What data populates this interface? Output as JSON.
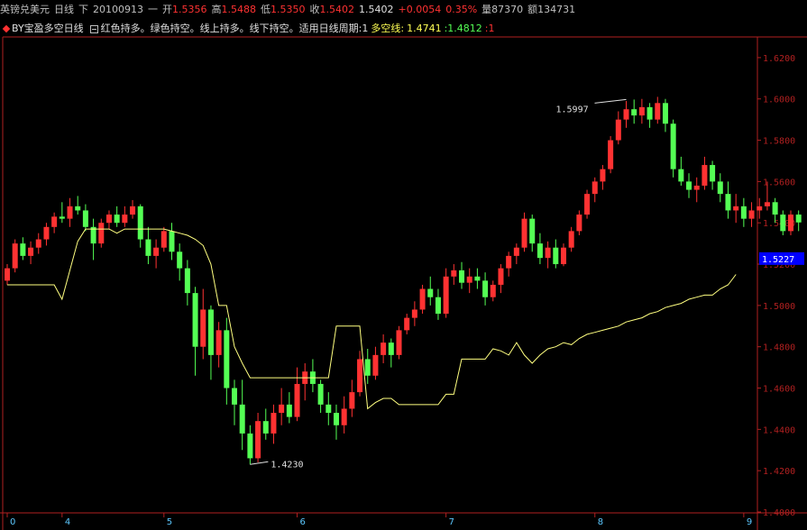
{
  "header": {
    "symbol": "英镑兑美元",
    "period": "日线",
    "direction": "下",
    "date": "20100913",
    "weekday": "一",
    "open_label": "开",
    "open": "1.5356",
    "high_label": "高",
    "high": "1.5488",
    "low_label": "低",
    "low": "1.5350",
    "close_label": "收",
    "close": "1.5402",
    "last": "1.5402",
    "change": "+0.0054",
    "change_pct": "0.35%",
    "volume_label": "量",
    "volume": "87370",
    "amount_label": "额",
    "amount": "134731"
  },
  "indicator": {
    "name": "BY宝盈多空日线",
    "description": "红色持多。绿色持空。线上持多。线下持空。适用日线周期:1",
    "line_label": "多空线:",
    "line_value": "1.4741",
    "value2": ":1.4812",
    "value3": ":1"
  },
  "colors": {
    "up": "#ff3232",
    "down": "#54ff54",
    "line": "#ffff80",
    "axis": "#b02020",
    "current_bg": "#0000ff"
  },
  "chart_data": {
    "type": "candlestick",
    "ylim": [
      1.4,
      1.63
    ],
    "y_ticks": [
      "1.6200",
      "1.6000",
      "1.5800",
      "1.5600",
      "1.5400",
      "1.5200",
      "1.5000",
      "1.4800",
      "1.4600",
      "1.4400",
      "1.4200",
      "1.4000"
    ],
    "x_ticks": [
      {
        "label": "0",
        "index": 0
      },
      {
        "label": "4",
        "index": 7
      },
      {
        "label": "5",
        "index": 20
      },
      {
        "label": "6",
        "index": 37
      },
      {
        "label": "7",
        "index": 56
      },
      {
        "label": "8",
        "index": 75
      },
      {
        "label": "9",
        "index": 94
      }
    ],
    "current_price": "1.5227",
    "annotations": [
      {
        "text": "1.5997",
        "index": 79,
        "value": 1.5997
      },
      {
        "text": "1.4230",
        "index": 31,
        "value": 1.423
      }
    ],
    "candles": [
      [
        1.512,
        1.52,
        1.51,
        1.518
      ],
      [
        1.518,
        1.532,
        1.516,
        1.53
      ],
      [
        1.53,
        1.533,
        1.522,
        1.524
      ],
      [
        1.524,
        1.531,
        1.52,
        1.528
      ],
      [
        1.528,
        1.535,
        1.525,
        1.532
      ],
      [
        1.532,
        1.54,
        1.529,
        1.538
      ],
      [
        1.538,
        1.545,
        1.535,
        1.543
      ],
      [
        1.543,
        1.55,
        1.54,
        1.542
      ],
      [
        1.542,
        1.552,
        1.538,
        1.548
      ],
      [
        1.548,
        1.553,
        1.544,
        1.546
      ],
      [
        1.546,
        1.549,
        1.536,
        1.538
      ],
      [
        1.538,
        1.542,
        1.522,
        1.53
      ],
      [
        1.53,
        1.542,
        1.528,
        1.54
      ],
      [
        1.54,
        1.546,
        1.537,
        1.544
      ],
      [
        1.544,
        1.548,
        1.538,
        1.54
      ],
      [
        1.54,
        1.548,
        1.538,
        1.544
      ],
      [
        1.544,
        1.551,
        1.542,
        1.548
      ],
      [
        1.548,
        1.549,
        1.528,
        1.532
      ],
      [
        1.532,
        1.538,
        1.52,
        1.524
      ],
      [
        1.524,
        1.532,
        1.518,
        1.528
      ],
      [
        1.528,
        1.538,
        1.526,
        1.536
      ],
      [
        1.536,
        1.54,
        1.522,
        1.526
      ],
      [
        1.526,
        1.53,
        1.512,
        1.518
      ],
      [
        1.518,
        1.522,
        1.5,
        1.506
      ],
      [
        1.506,
        1.509,
        1.466,
        1.48
      ],
      [
        1.48,
        1.508,
        1.474,
        1.498
      ],
      [
        1.498,
        1.5,
        1.464,
        1.476
      ],
      [
        1.476,
        1.492,
        1.47,
        1.488
      ],
      [
        1.488,
        1.494,
        1.452,
        1.46
      ],
      [
        1.46,
        1.464,
        1.442,
        1.452
      ],
      [
        1.452,
        1.464,
        1.43,
        1.438
      ],
      [
        1.438,
        1.442,
        1.423,
        1.426
      ],
      [
        1.426,
        1.448,
        1.424,
        1.444
      ],
      [
        1.444,
        1.45,
        1.435,
        1.438
      ],
      [
        1.438,
        1.452,
        1.433,
        1.448
      ],
      [
        1.448,
        1.46,
        1.442,
        1.452
      ],
      [
        1.452,
        1.458,
        1.443,
        1.446
      ],
      [
        1.446,
        1.47,
        1.444,
        1.462
      ],
      [
        1.462,
        1.472,
        1.454,
        1.468
      ],
      [
        1.468,
        1.474,
        1.458,
        1.462
      ],
      [
        1.462,
        1.464,
        1.448,
        1.452
      ],
      [
        1.452,
        1.458,
        1.442,
        1.448
      ],
      [
        1.448,
        1.452,
        1.435,
        1.442
      ],
      [
        1.442,
        1.456,
        1.438,
        1.45
      ],
      [
        1.45,
        1.464,
        1.446,
        1.458
      ],
      [
        1.458,
        1.478,
        1.456,
        1.474
      ],
      [
        1.474,
        1.479,
        1.462,
        1.466
      ],
      [
        1.466,
        1.48,
        1.464,
        1.476
      ],
      [
        1.476,
        1.486,
        1.472,
        1.482
      ],
      [
        1.482,
        1.484,
        1.47,
        1.476
      ],
      [
        1.476,
        1.49,
        1.474,
        1.488
      ],
      [
        1.488,
        1.496,
        1.486,
        1.494
      ],
      [
        1.494,
        1.502,
        1.49,
        1.498
      ],
      [
        1.498,
        1.51,
        1.496,
        1.508
      ],
      [
        1.508,
        1.514,
        1.5,
        1.504
      ],
      [
        1.504,
        1.508,
        1.493,
        1.496
      ],
      [
        1.496,
        1.518,
        1.494,
        1.514
      ],
      [
        1.514,
        1.52,
        1.51,
        1.517
      ],
      [
        1.517,
        1.521,
        1.508,
        1.511
      ],
      [
        1.511,
        1.518,
        1.506,
        1.514
      ],
      [
        1.514,
        1.518,
        1.508,
        1.512
      ],
      [
        1.512,
        1.516,
        1.5,
        1.504
      ],
      [
        1.504,
        1.512,
        1.502,
        1.51
      ],
      [
        1.51,
        1.52,
        1.506,
        1.518
      ],
      [
        1.518,
        1.526,
        1.514,
        1.524
      ],
      [
        1.524,
        1.53,
        1.52,
        1.528
      ],
      [
        1.528,
        1.545,
        1.526,
        1.542
      ],
      [
        1.542,
        1.544,
        1.526,
        1.53
      ],
      [
        1.53,
        1.535,
        1.52,
        1.523
      ],
      [
        1.523,
        1.531,
        1.518,
        1.528
      ],
      [
        1.528,
        1.532,
        1.518,
        1.52
      ],
      [
        1.52,
        1.53,
        1.519,
        1.528
      ],
      [
        1.528,
        1.538,
        1.526,
        1.536
      ],
      [
        1.536,
        1.546,
        1.534,
        1.544
      ],
      [
        1.544,
        1.556,
        1.542,
        1.554
      ],
      [
        1.554,
        1.562,
        1.55,
        1.56
      ],
      [
        1.56,
        1.568,
        1.556,
        1.566
      ],
      [
        1.566,
        1.582,
        1.564,
        1.58
      ],
      [
        1.58,
        1.594,
        1.578,
        1.59
      ],
      [
        1.59,
        1.599,
        1.586,
        1.595
      ],
      [
        1.595,
        1.5997,
        1.588,
        1.592
      ],
      [
        1.592,
        1.6,
        1.588,
        1.596
      ],
      [
        1.596,
        1.598,
        1.586,
        1.59
      ],
      [
        1.59,
        1.601,
        1.588,
        1.598
      ],
      [
        1.598,
        1.6,
        1.584,
        1.588
      ],
      [
        1.588,
        1.59,
        1.562,
        1.566
      ],
      [
        1.566,
        1.572,
        1.558,
        1.56
      ],
      [
        1.56,
        1.564,
        1.552,
        1.556
      ],
      [
        1.556,
        1.562,
        1.55,
        1.558
      ],
      [
        1.558,
        1.572,
        1.556,
        1.568
      ],
      [
        1.568,
        1.57,
        1.556,
        1.56
      ],
      [
        1.56,
        1.564,
        1.55,
        1.554
      ],
      [
        1.554,
        1.56,
        1.542,
        1.546
      ],
      [
        1.546,
        1.554,
        1.54,
        1.548
      ],
      [
        1.548,
        1.552,
        1.538,
        1.542
      ],
      [
        1.542,
        1.55,
        1.538,
        1.546
      ],
      [
        1.546,
        1.552,
        1.542,
        1.548
      ],
      [
        1.548,
        1.56,
        1.546,
        1.55
      ],
      [
        1.55,
        1.552,
        1.54,
        1.544
      ],
      [
        1.544,
        1.546,
        1.534,
        1.536
      ],
      [
        1.536,
        1.546,
        1.534,
        1.544
      ],
      [
        1.544,
        1.546,
        1.536,
        1.5402
      ]
    ],
    "line": [
      1.51,
      1.51,
      1.51,
      1.51,
      1.51,
      1.51,
      1.51,
      1.503,
      1.517,
      1.531,
      1.537,
      1.537,
      1.537,
      1.537,
      1.535,
      1.537,
      1.537,
      1.537,
      1.537,
      1.537,
      1.537,
      1.536,
      1.535,
      1.534,
      1.532,
      1.529,
      1.52,
      1.5,
      1.5,
      1.48,
      1.472,
      1.465,
      1.465,
      1.465,
      1.465,
      1.465,
      1.465,
      1.465,
      1.465,
      1.465,
      1.465,
      1.465,
      1.49,
      1.49,
      1.49,
      1.49,
      1.45,
      1.453,
      1.455,
      1.455,
      1.452,
      1.452,
      1.452,
      1.452,
      1.452,
      1.452,
      1.457,
      1.457,
      1.474,
      1.474,
      1.474,
      1.474,
      1.479,
      1.478,
      1.476,
      1.482,
      1.476,
      1.472,
      1.476,
      1.479,
      1.48,
      1.482,
      1.481,
      1.484,
      1.486,
      1.487,
      1.488,
      1.489,
      1.49,
      1.492,
      1.493,
      1.494,
      1.496,
      1.497,
      1.499,
      1.5,
      1.501,
      1.503,
      1.504,
      1.505,
      1.505,
      1.508,
      1.51,
      1.515
    ]
  }
}
